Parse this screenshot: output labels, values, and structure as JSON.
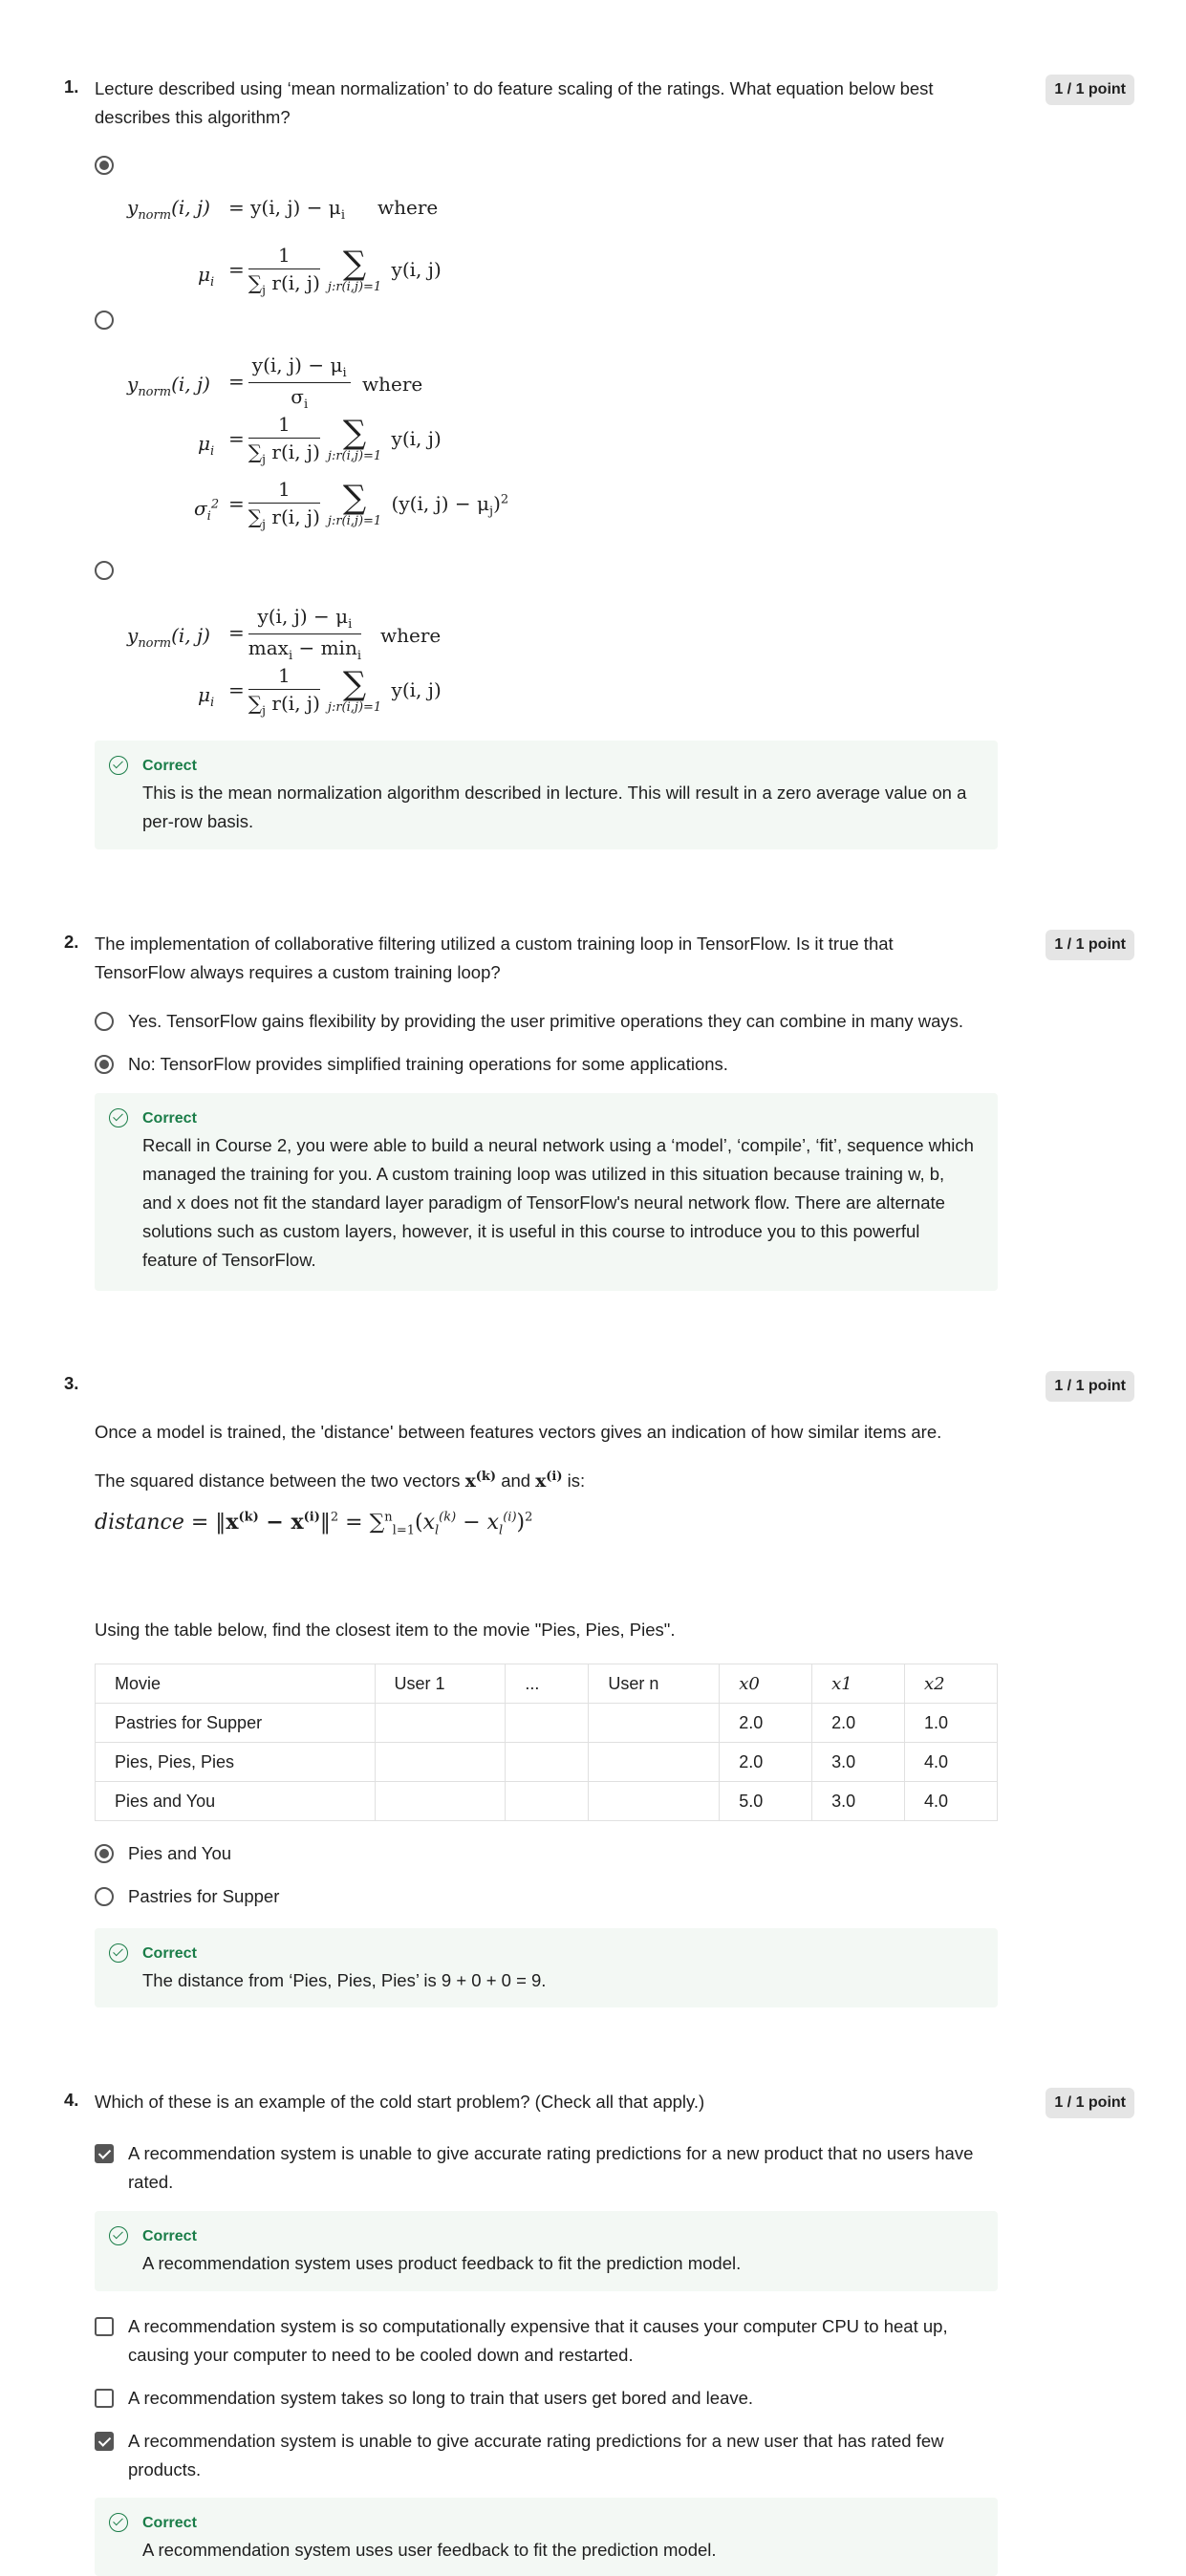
{
  "score_label": "1 / 1 point",
  "feedback_title": "Correct",
  "q1": {
    "number": "1.",
    "text": "Lecture described using ‘mean normalization’ to do feature scaling of the ratings. What equation below best describes this algorithm?",
    "where": "where",
    "feedback": "This is the mean normalization algorithm described in lecture. This will result in a zero average value on a per-row basis."
  },
  "q2": {
    "number": "2.",
    "text": "The implementation of collaborative filtering utilized a custom training loop in TensorFlow. Is it true that TensorFlow always requires a custom training loop?",
    "options": [
      {
        "label": "Yes. TensorFlow gains flexibility by providing the user primitive operations they can combine in many ways.",
        "selected": false
      },
      {
        "label": "No: TensorFlow provides simplified training operations for some applications.",
        "selected": true
      }
    ],
    "feedback_lines": [
      "Recall in Course 2, you were able to build a neural network using a ‘model’, ‘compile’, ‘fit’, sequence which",
      "managed the training for you. A custom training loop was utilized in this situation because training w, b,",
      "and x does not fit the standard layer paradigm of TensorFlow's neural network flow. There are alternate",
      "solutions such as custom layers, however, it is useful in this course to introduce you to this powerful",
      "feature of TensorFlow."
    ]
  },
  "q3": {
    "number": "3.",
    "intro": "Once a model is trained, the 'distance' between features vectors gives an indication of how similar items are.",
    "squared_a": "The squared distance between the two vectors",
    "squared_and": "and",
    "squared_is": "is:",
    "table_prompt": "Using the table below, find the closest item to the movie \"Pies, Pies, Pies\".",
    "table": {
      "headers": [
        "Movie",
        "User 1",
        "...",
        "User n",
        "x0",
        "x1",
        "x2"
      ],
      "rows": [
        [
          "Pastries for Supper",
          "",
          "",
          "",
          "2.0",
          "2.0",
          "1.0"
        ],
        [
          "Pies, Pies, Pies",
          "",
          "",
          "",
          "2.0",
          "3.0",
          "4.0"
        ],
        [
          "Pies and You",
          "",
          "",
          "",
          "5.0",
          "3.0",
          "4.0"
        ]
      ]
    },
    "options": [
      {
        "label": "Pies and You",
        "selected": true
      },
      {
        "label": "Pastries for Supper",
        "selected": false
      }
    ],
    "feedback": "The distance from ‘Pies, Pies, Pies’ is 9 + 0 + 0 = 9."
  },
  "q4": {
    "number": "4.",
    "text": "Which of these is an example of the cold start problem? (Check all that apply.)",
    "options": [
      {
        "label": "A recommendation system is unable to give accurate rating predictions for a new product that no users have rated.",
        "selected": true,
        "feedback": "A recommendation system uses product feedback to fit the prediction model."
      },
      {
        "label": "A recommendation system is so computationally expensive that it causes your computer CPU to heat up, causing your computer to need to be cooled down and restarted.",
        "selected": false
      },
      {
        "label": "A recommendation system takes so long to train that users get bored and leave.",
        "selected": false
      },
      {
        "label": "A recommendation system is unable to give accurate rating predictions for a new user that has rated few products.",
        "selected": true,
        "feedback": "A recommendation system uses user feedback to fit the prediction model."
      }
    ]
  }
}
